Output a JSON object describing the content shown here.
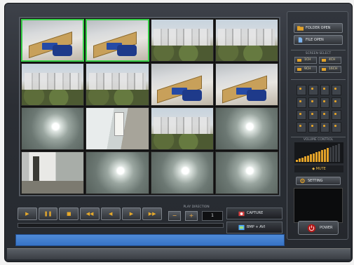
{
  "window": {
    "title": ""
  },
  "grid": {
    "cells": [
      {
        "scene": "office",
        "selected": true
      },
      {
        "scene": "office",
        "selected": true
      },
      {
        "scene": "city",
        "selected": false
      },
      {
        "scene": "city",
        "selected": false
      },
      {
        "scene": "city",
        "selected": false
      },
      {
        "scene": "city",
        "selected": false
      },
      {
        "scene": "office",
        "selected": false
      },
      {
        "scene": "office",
        "selected": false
      },
      {
        "scene": "lamp",
        "selected": false
      },
      {
        "scene": "room",
        "selected": false
      },
      {
        "scene": "city",
        "selected": false
      },
      {
        "scene": "lamp",
        "selected": false
      },
      {
        "scene": "room2",
        "selected": false
      },
      {
        "scene": "lamp",
        "selected": false
      },
      {
        "scene": "lamp",
        "selected": false
      },
      {
        "scene": "lamp",
        "selected": false
      }
    ]
  },
  "panel": {
    "folder_open": "FOLDER OPEN",
    "file_open": "FILE OPEN",
    "screen_select_label": "SCREEN SELECT",
    "split_buttons": [
      "1CH",
      "4CH",
      "9CH",
      "16CH"
    ],
    "volume_label": "VOLUME CONTROL",
    "mute": "MUTE",
    "setting": "SETTING",
    "power": "POWER",
    "volume_level": 0.72
  },
  "transport": {
    "buttons": [
      {
        "icon": "play-icon",
        "glyph": "▶"
      },
      {
        "icon": "pause-icon",
        "glyph": "❚❚"
      },
      {
        "icon": "stop-icon",
        "glyph": "■"
      },
      {
        "icon": "rewind-icon",
        "glyph": "◀◀"
      },
      {
        "icon": "step-back-icon",
        "glyph": "◀"
      },
      {
        "icon": "step-forward-icon",
        "glyph": "▶"
      },
      {
        "icon": "fast-forward-icon",
        "glyph": "▶▶"
      }
    ],
    "speed_label": "PLAY DIRECTION",
    "minus": "−",
    "plus": "+",
    "speed_value": "1",
    "capture": "CAPTURE",
    "bmp_avi": "BMP + AVI"
  },
  "status_bar": {
    "text": ""
  },
  "colors": {
    "accent": "#e2a229",
    "selected": "#39d14a",
    "status": "#3f7ccf"
  }
}
